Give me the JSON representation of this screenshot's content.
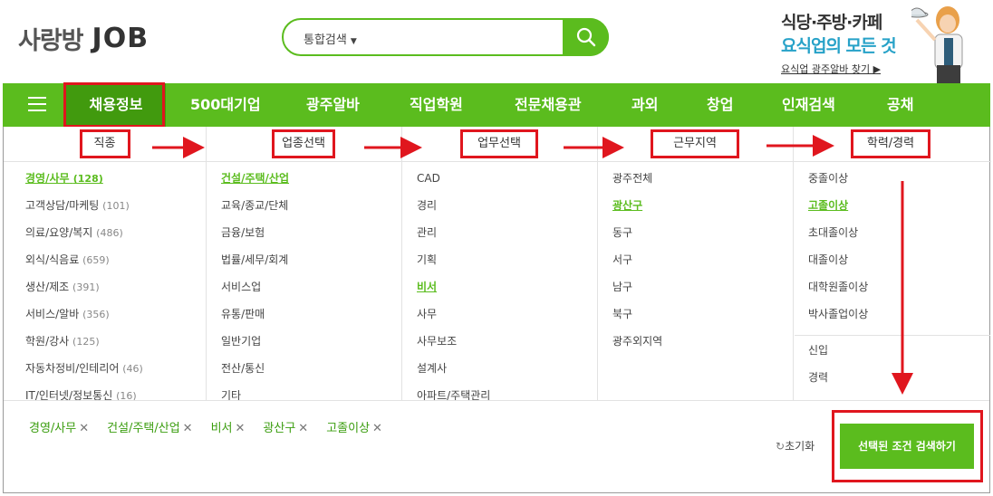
{
  "header": {
    "logo_ko": "사랑방",
    "logo_job": "JOB",
    "search_select": "통합검색",
    "ad_line1": "식당·주방·카페",
    "ad_line2": "요식업의 모든 것",
    "ad_link": "요식업 광주알바 찾기 ▶"
  },
  "nav": {
    "items": [
      "채용정보",
      "500대기업",
      "광주알바",
      "직업학원",
      "전문채용관",
      "과외",
      "창업",
      "인재검색",
      "공채"
    ]
  },
  "columns": {
    "job_type": {
      "header": "직종",
      "items": [
        {
          "label": "경영/사무",
          "count": "(128)"
        },
        {
          "label": "고객상담/마케팅",
          "count": "(101)"
        },
        {
          "label": "의료/요양/복지",
          "count": "(486)"
        },
        {
          "label": "외식/식음료",
          "count": "(659)"
        },
        {
          "label": "생산/제조",
          "count": "(391)"
        },
        {
          "label": "서비스/알바",
          "count": "(356)"
        },
        {
          "label": "학원/강사",
          "count": "(125)"
        },
        {
          "label": "자동차정비/인테리어",
          "count": "(46)"
        },
        {
          "label": "IT/인터넷/정보통신",
          "count": "(16)"
        }
      ]
    },
    "industry": {
      "header": "업종선택",
      "items": [
        "건설/주택/산업",
        "교육/종교/단체",
        "금융/보험",
        "법률/세무/회계",
        "서비스업",
        "유통/판매",
        "일반기업",
        "전산/통신",
        "기타"
      ]
    },
    "duty": {
      "header": "업무선택",
      "items": [
        "CAD",
        "경리",
        "관리",
        "기획",
        "비서",
        "사무",
        "사무보조",
        "설계사",
        "아파트/주택관리"
      ]
    },
    "location": {
      "header": "근무지역",
      "items": [
        "광주전체",
        "광산구",
        "동구",
        "서구",
        "남구",
        "북구",
        "광주외지역"
      ]
    },
    "education": {
      "header": "학력/경력",
      "items": [
        "중졸이상",
        "고졸이상",
        "초대졸이상",
        "대졸이상",
        "대학원졸이상",
        "박사졸업이상"
      ],
      "career": [
        "신입",
        "경력"
      ]
    }
  },
  "selected_tags": [
    "경영/사무",
    "건설/주택/산업",
    "비서",
    "광산구",
    "고졸이상"
  ],
  "reset_label": "초기화",
  "search_button": "선택된 조건 검색하기",
  "colors": {
    "brand_green": "#5bbc1e",
    "active_nav": "#419a0e",
    "annotation_red": "#e0161e",
    "ad_blue": "#27a2c8"
  }
}
